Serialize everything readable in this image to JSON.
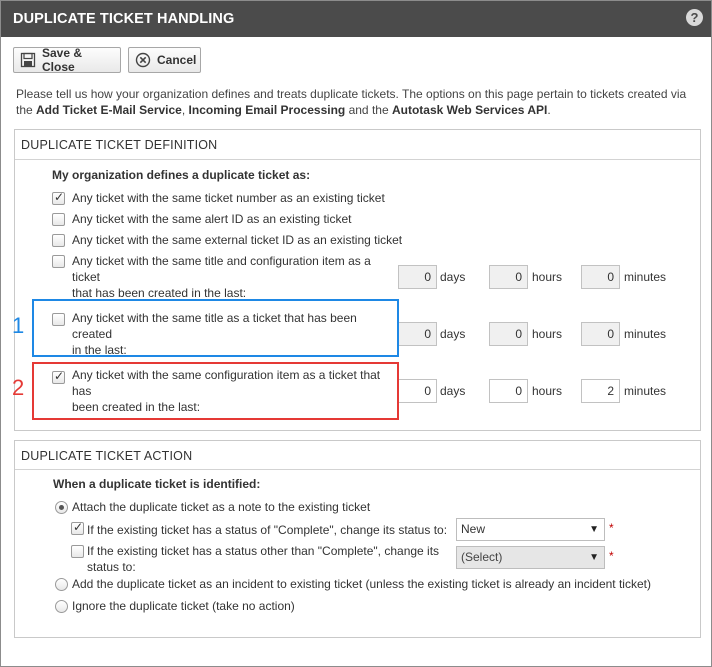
{
  "window": {
    "title": "DUPLICATE TICKET HANDLING",
    "help_glyph": "?"
  },
  "toolbar": {
    "save_close": "Save & Close",
    "cancel": "Cancel"
  },
  "intro": {
    "text1": "Please tell us how your organization defines and treats duplicate tickets. The options on this page pertain to tickets created via the ",
    "link1": "Add Ticket E-Mail Service",
    "sep1": ", ",
    "link2": "Incoming Email Processing",
    "sep2": " and the ",
    "link3": "Autotask Web Services API",
    "end": "."
  },
  "definition": {
    "title": "DUPLICATE TICKET DEFINITION",
    "prompt": "My organization defines a duplicate ticket as:",
    "options": [
      {
        "line1": "Any ticket with the same ticket number as an existing ticket",
        "checked": true
      },
      {
        "line1": "Any ticket with the same alert ID as an existing ticket",
        "checked": false
      },
      {
        "line1": "Any ticket with the same external ticket ID as an existing ticket",
        "checked": false
      },
      {
        "line1": "Any ticket with the same title and configuration item as a",
        "line2": "ticket",
        "line3": "that has been created in the last:",
        "checked": false,
        "days": "0",
        "hours": "0",
        "minutes": "0"
      },
      {
        "line1": "Any ticket with the same title as a ticket that has been",
        "line2": "created",
        "line3": "in the last:",
        "checked": false,
        "days": "0",
        "hours": "0",
        "minutes": "0"
      },
      {
        "line1": "Any ticket with the same configuration item as a ticket that",
        "line2": "has",
        "line3": "been created in the last:",
        "checked": true,
        "days": "0",
        "hours": "0",
        "minutes": "2"
      }
    ],
    "units": {
      "days": "days",
      "hours": "hours",
      "minutes": "minutes"
    }
  },
  "annotations": [
    {
      "label": "1",
      "color": "#1e88e5"
    },
    {
      "label": "2",
      "color": "#e53935"
    }
  ],
  "action": {
    "title": "DUPLICATE TICKET ACTION",
    "prompt": "When a duplicate ticket is identified:",
    "attach": {
      "label": "Attach the duplicate ticket as a note to the existing ticket",
      "selected": true
    },
    "sub_complete": {
      "label": "If the existing ticket has a status of \"Complete\", change its status to:",
      "checked": true,
      "value": "New"
    },
    "sub_other": {
      "line1": "If the existing ticket has a status other than \"Complete\", change its",
      "line2": "status to:",
      "checked": false,
      "value": "(Select)"
    },
    "incident": {
      "label": "Add the duplicate ticket as an incident to existing ticket (unless the existing ticket is already an incident ticket)",
      "selected": false
    },
    "ignore": {
      "label": "Ignore the duplicate ticket (take no action)",
      "selected": false
    },
    "required_mark": "*"
  }
}
